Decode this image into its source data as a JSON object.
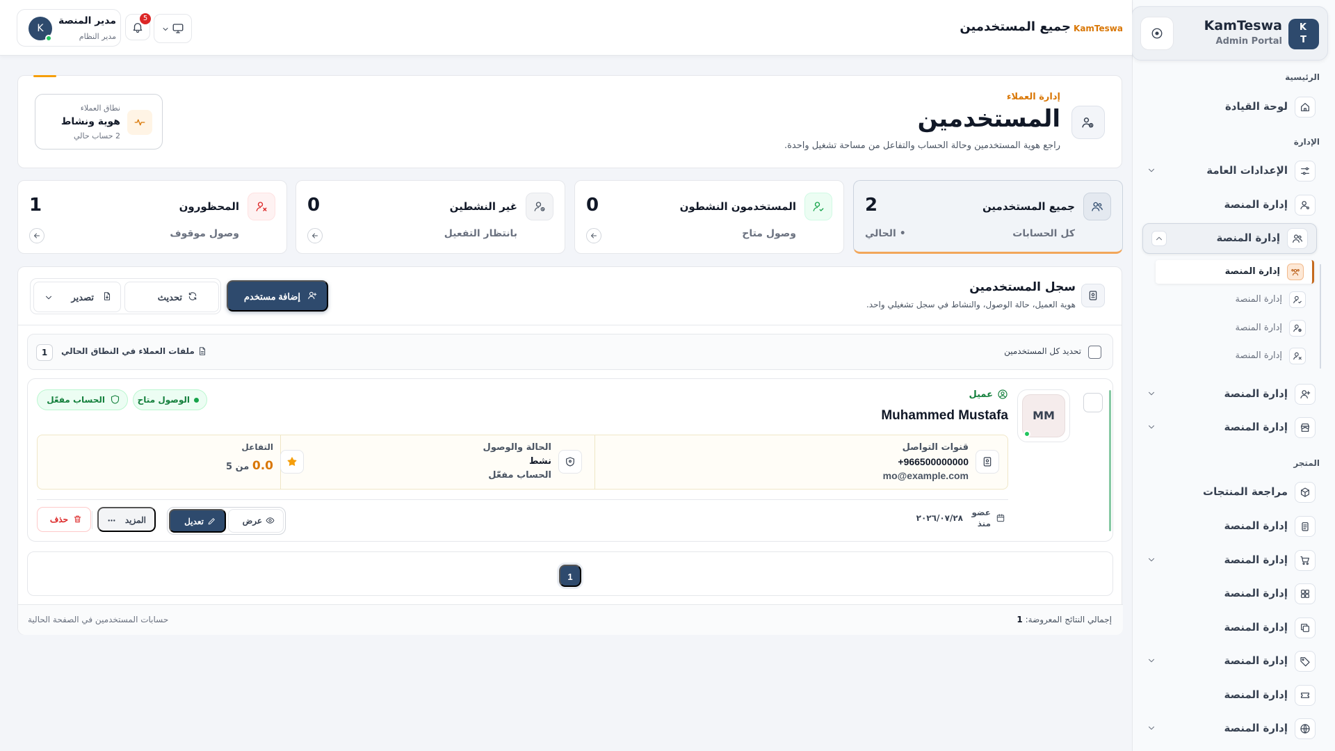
{
  "sidebar": {
    "brand": {
      "logo": "KT",
      "name": "KamTeswa",
      "subtitle": "Admin Portal"
    },
    "sections": {
      "home": "الرئيسية",
      "admin": "الإدارة",
      "store": "المتجر"
    },
    "items": {
      "dashboard": "لوحة القيادة",
      "general_settings": "الإعدادات العامة",
      "platform_mgmt_1": "إدارة المنصة",
      "platform_mgmt_active": "إدارة المنصة",
      "platform_mgmt_4": "إدارة المنصة",
      "platform_mgmt_5": "إدارة المنصة",
      "product_reviews": "مراجعة المنتجات",
      "platform_mgmt_7": "إدارة المنصة",
      "platform_mgmt_8": "إدارة المنصة",
      "platform_mgmt_9": "إدارة المنصة",
      "platform_mgmt_10": "إدارة المنصة",
      "platform_mgmt_11": "إدارة المنصة",
      "platform_mgmt_12": "إدارة المنصة",
      "platform_mgmt_13": "إدارة المنصة"
    },
    "sub_items": [
      "إدارة المنصة",
      "إدارة المنصة",
      "إدارة المنصة",
      "إدارة المنصة"
    ]
  },
  "header": {
    "brand_crumb": "KamTeswa",
    "title": "جميع المستخدمين",
    "user": {
      "initial": "K",
      "name": "مدير المنصة",
      "role": "مدير النظام"
    },
    "notifications_count": "5"
  },
  "hero": {
    "eyebrow": "إدارة العملاء",
    "title": "المستخدمين",
    "description": "راجع هوية المستخدمين وحالة الحساب والتفاعل من مساحة تشغيل واحدة.",
    "scope": {
      "label": "نطاق العملاء",
      "value": "هوية ونشاط",
      "count": "2 حساب حالي"
    }
  },
  "stats": [
    {
      "label": "جميع المستخدمين",
      "value": "2",
      "sub": "كل الحسابات",
      "current": "• الحالي"
    },
    {
      "label": "المستخدمون النشطون",
      "value": "0",
      "sub": "وصول متاح"
    },
    {
      "label": "غير النشطين",
      "value": "0",
      "sub": "بانتظار التفعيل"
    },
    {
      "label": "المحظورون",
      "value": "1",
      "sub": "وصول موقوف"
    }
  ],
  "users_panel": {
    "title": "سجل المستخدمين",
    "subtitle": "هوية العميل، حالة الوصول، والنشاط في سجل تشغيلي واحد.",
    "add_label": "إضافة مستخدم",
    "refresh_label": "تحديث",
    "export_label": "تصدير",
    "select_all_label": "تحديد كل المستخدمين",
    "files_label": "ملفات العملاء في النطاق الحالي",
    "files_count": "1",
    "user": {
      "initials": "MM",
      "role": "عميل",
      "name": "Muhammed Mustafa",
      "access_pill": "الوصول متاح",
      "account_pill": "الحساب مفعّل",
      "contact_title": "قنوات التواصل",
      "phone": "+966500000000",
      "email": "mo@example.com",
      "status_title": "الحالة والوصول",
      "status_value": "نشط",
      "status_account": "الحساب مفعّل",
      "engagement_title": "التفاعل",
      "engagement_score": "0.0",
      "engagement_suffix": "من 5",
      "member_label": "عضو منذ",
      "member_date": "٢٠٢٦/٠٧/٢٨",
      "view_label": "عرض",
      "edit_label": "تعديل",
      "more_label": "المزيد",
      "delete_label": "حذف"
    },
    "page": "1",
    "total_label": "إجمالي النتائج المعروضة:",
    "total_value": "1",
    "footer_note": "حسابات المستخدمين في الصفحة الحالية"
  },
  "colors": {
    "primary": "#2e4a6d",
    "accent": "#d97706",
    "success": "#15803d",
    "danger": "#dc2626"
  }
}
